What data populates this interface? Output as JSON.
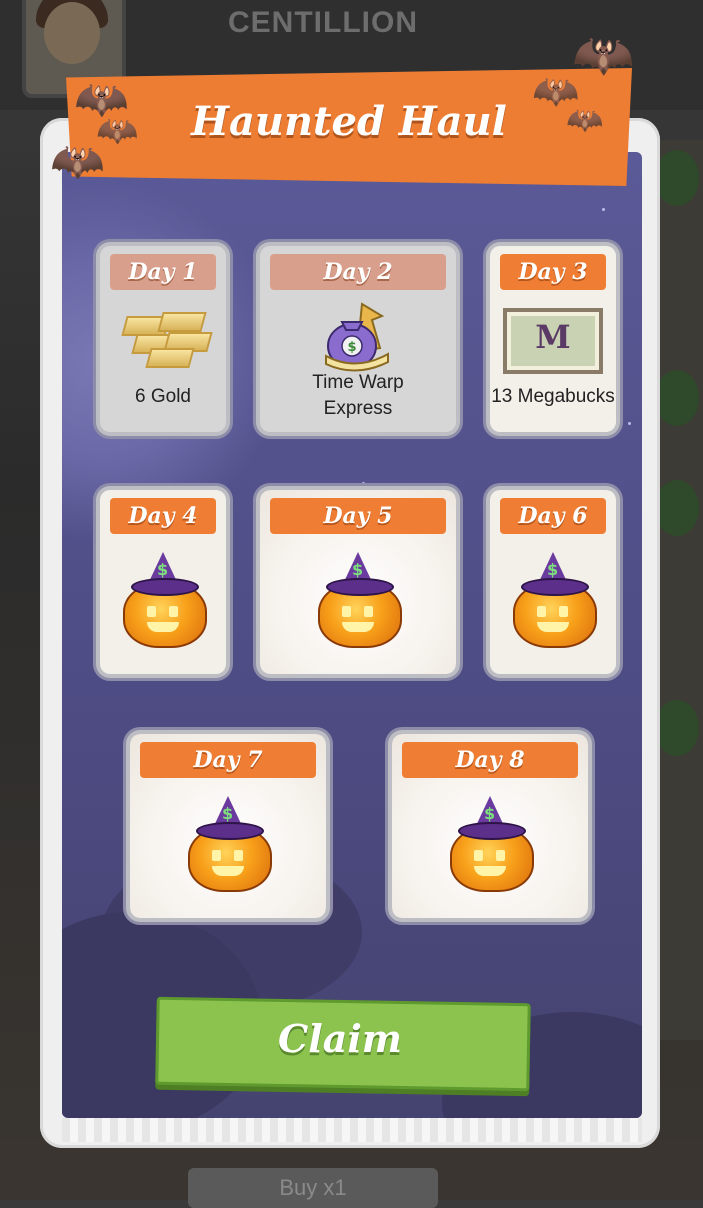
{
  "background": {
    "title": "CENTILLION",
    "buy_button": "Buy x1"
  },
  "dialog": {
    "title": "Haunted Haul",
    "claim_label": "Claim"
  },
  "days": [
    {
      "label": "Day 1",
      "reward": "6 Gold",
      "icon": "gold-bars-icon",
      "state": "claimed"
    },
    {
      "label": "Day 2",
      "reward_line1": "Time Warp",
      "reward_line2": "Express",
      "icon": "money-bag-icon",
      "state": "claimed"
    },
    {
      "label": "Day 3",
      "reward": "13 Megabucks",
      "megabuck_symbol": "M",
      "icon": "megabucks-icon",
      "state": "current"
    },
    {
      "label": "Day 4",
      "icon": "pumpkin-icon",
      "state": "locked"
    },
    {
      "label": "Day 5",
      "icon": "pumpkin-icon",
      "state": "locked"
    },
    {
      "label": "Day 6",
      "icon": "pumpkin-icon",
      "state": "locked"
    },
    {
      "label": "Day 7",
      "icon": "pumpkin-icon",
      "state": "locked"
    },
    {
      "label": "Day 8",
      "icon": "pumpkin-icon",
      "state": "locked"
    }
  ],
  "pumpkin_hat_symbol": "$",
  "colors": {
    "banner": "#ee7d34",
    "panel": "#5b5a98",
    "claim_button": "#8cc34f",
    "day_tag": "#ef7d33"
  }
}
